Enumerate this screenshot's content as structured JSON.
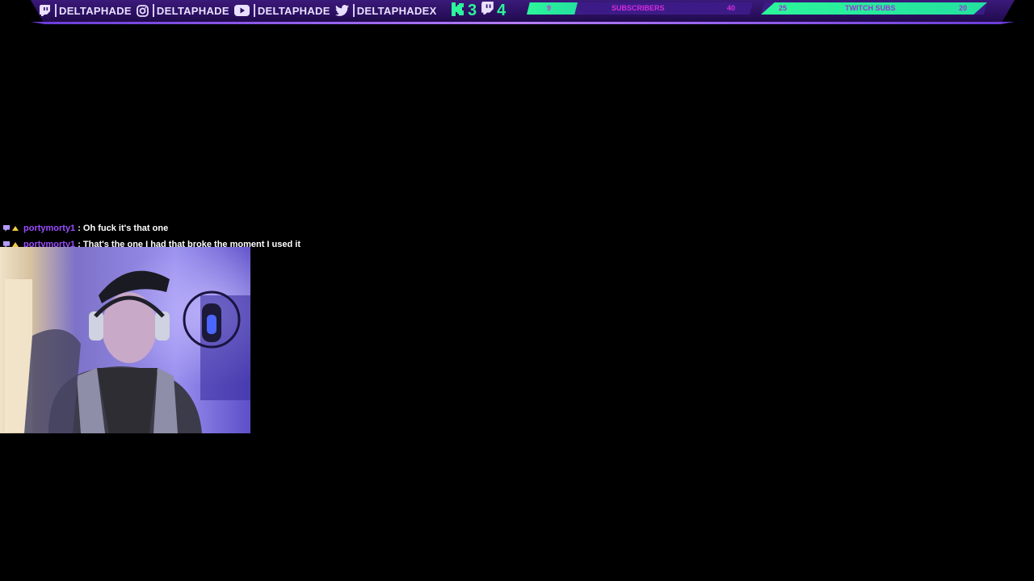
{
  "overlay": {
    "socials": [
      {
        "platform": "twitch",
        "icon": "twitch-icon",
        "handle": "DELTAPHADE"
      },
      {
        "platform": "instagram",
        "icon": "instagram-icon",
        "handle": "DELTAPHADE"
      },
      {
        "platform": "youtube",
        "icon": "youtube-icon",
        "handle": "DELTAPHADE"
      },
      {
        "platform": "twitter",
        "icon": "twitter-icon",
        "handle": "DELTAPHADEX"
      }
    ],
    "counters": [
      {
        "icon": "kick-icon",
        "value": "3"
      },
      {
        "icon": "twitch-icon",
        "value": "4"
      }
    ],
    "goals": [
      {
        "label": "SUBSCRIBERS",
        "current": "9",
        "target": "40",
        "progress": 0.225
      },
      {
        "label": "TWITCH SUBS",
        "current": "25",
        "target": "20",
        "progress": 1.0
      }
    ],
    "colors": {
      "accent": "#2cf59a",
      "bar": "#2a0f5e",
      "track": "#3d1b87",
      "text": "#e9e0ff",
      "goal_text": "#d42be0"
    }
  },
  "chat": {
    "messages": [
      {
        "user": "portymorty1",
        "text": ": Oh fuck it's that one"
      },
      {
        "user": "portymorty1",
        "text": ": That's the one I had that broke the moment I used it"
      }
    ]
  },
  "webcam": {
    "label": ""
  }
}
